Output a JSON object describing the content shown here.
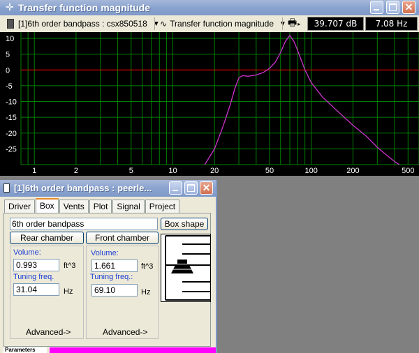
{
  "main_window": {
    "title": "Transfer function magnitude",
    "buttons": {
      "minimize": "minimize",
      "maximize": "maximize",
      "close": "close"
    }
  },
  "toolbar": {
    "project_combo": "[1]6th order bandpass : csx850518",
    "graph_combo": "Transfer function magnitude",
    "readout_db": "39.707 dB",
    "readout_hz": "7.08 Hz"
  },
  "chart_data": {
    "type": "line",
    "x_scale": "log",
    "xlim": [
      0.8,
      600
    ],
    "ylim": [
      -30,
      12
    ],
    "x_ticks": [
      1,
      2,
      5,
      10,
      20,
      50,
      100,
      200,
      500
    ],
    "x_tick_labels": [
      "1",
      "2",
      "5",
      "10",
      "20",
      "50",
      "100",
      "200",
      "500"
    ],
    "y_ticks": [
      10,
      5,
      0,
      -5,
      -10,
      -15,
      -20,
      -25
    ],
    "y_tick_labels": [
      "10",
      "5",
      "0",
      "-5",
      "-10",
      "-15",
      "-20",
      "-25"
    ],
    "grid": true,
    "colors": {
      "background": "#000000",
      "grid": "#008000",
      "zero_line": "#ff0000",
      "series": "#cc33cc"
    },
    "series": [
      {
        "x": [
          17,
          20,
          23,
          26,
          28,
          30,
          32,
          35,
          40,
          45,
          50,
          55,
          60,
          65,
          70,
          75,
          80,
          90,
          100,
          120,
          150,
          200,
          250,
          300,
          350,
          400,
          450,
          490
        ],
        "y": [
          -30,
          -25,
          -18,
          -11,
          -6,
          -2.5,
          -1.8,
          -2,
          -1.6,
          -0.8,
          0.5,
          2.5,
          5.5,
          9,
          11,
          9,
          6,
          0,
          -4,
          -8.5,
          -12.5,
          -17.5,
          -21,
          -24.5,
          -27,
          -29,
          -30.5,
          -31
        ]
      }
    ]
  },
  "child_window": {
    "title": "[1]6th order bandpass : peerle...",
    "tabs": [
      "Driver",
      "Box",
      "Vents",
      "Plot",
      "Signal",
      "Project"
    ],
    "active_tab": "Box",
    "box_type": "6th order bandpass",
    "box_shape_button": "Box shape",
    "rear": {
      "heading": "Rear chamber",
      "volume_label": "Volume:",
      "volume_value": "0.993",
      "volume_unit": "ft^3",
      "tuning_label": "Tuning freq.",
      "tuning_value": "31.04",
      "tuning_unit": "Hz",
      "advanced": "Advanced->"
    },
    "front": {
      "heading": "Front chamber",
      "volume_label": "Volume:",
      "volume_value": "1.661",
      "volume_unit": "ft^3",
      "tuning_label": "Tuning freq.:",
      "tuning_value": "69.10",
      "tuning_unit": "Hz",
      "advanced": "Advanced->"
    },
    "status_label": "Parameters"
  }
}
